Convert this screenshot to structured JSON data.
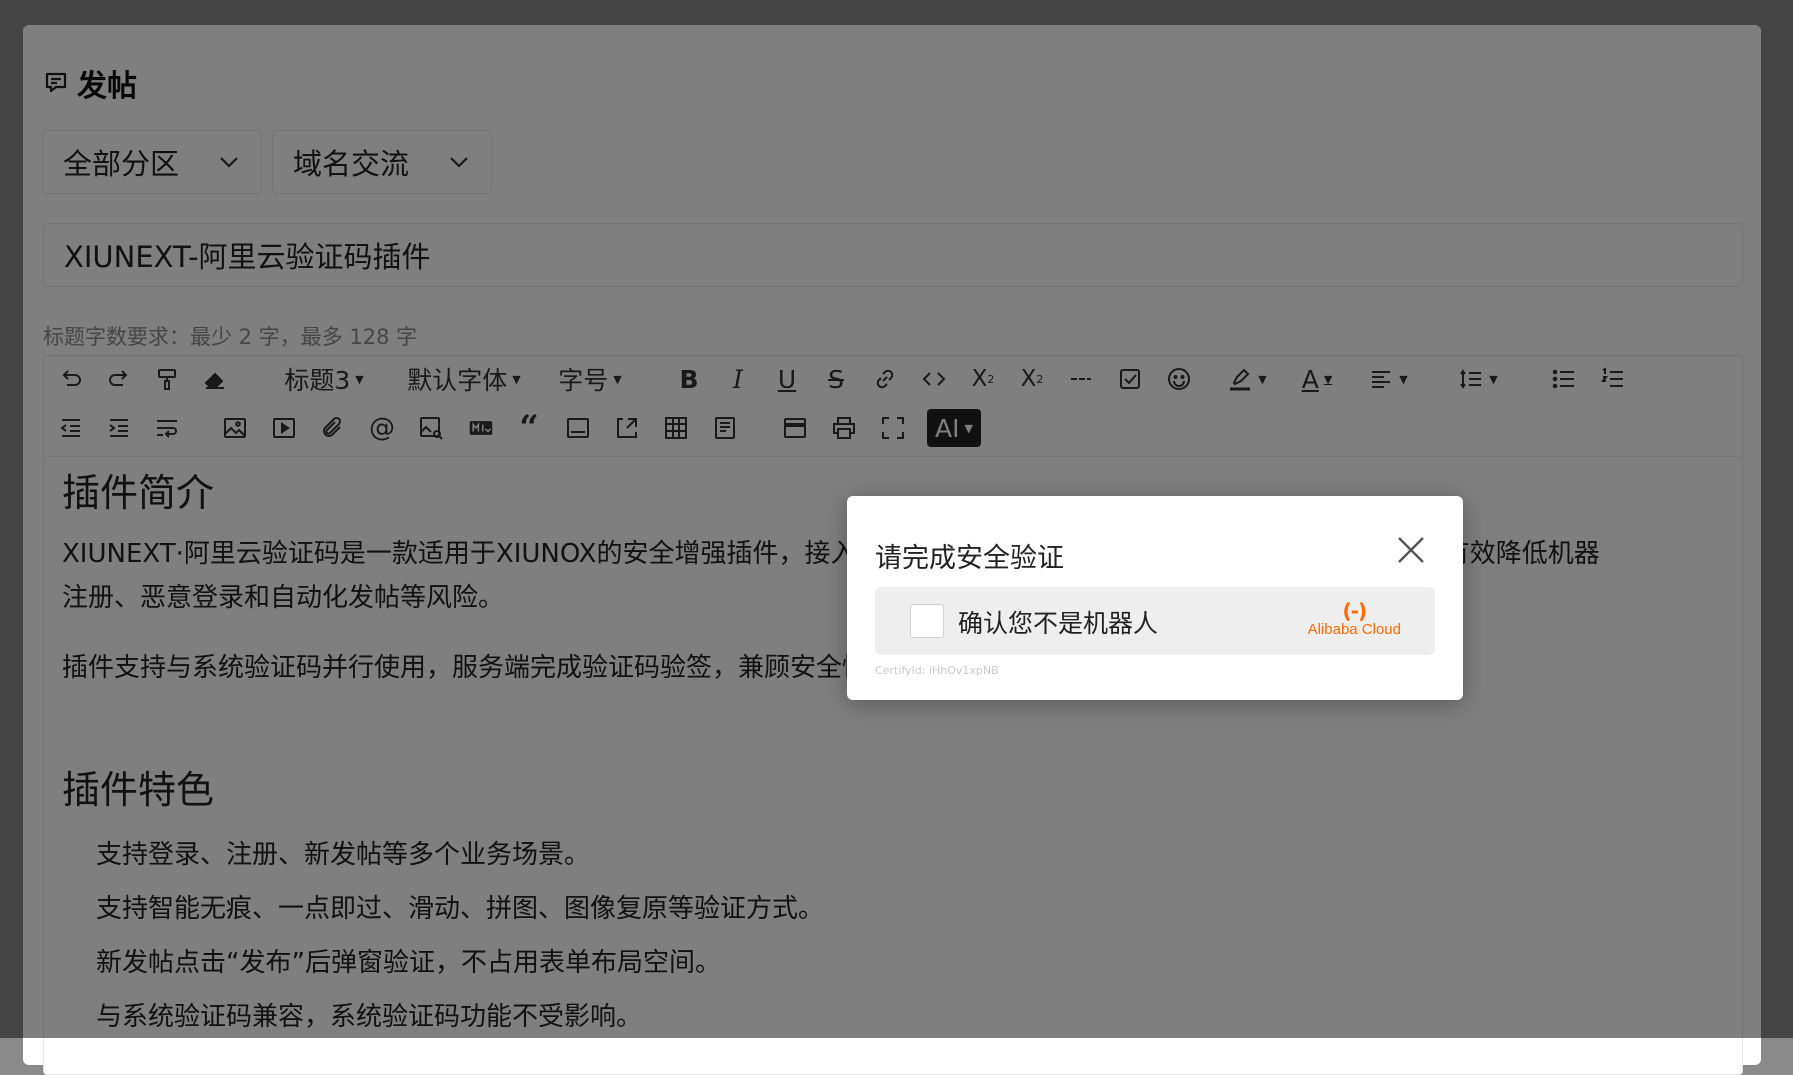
{
  "page": {
    "title": "发帖",
    "icon": "post-icon"
  },
  "selects": [
    {
      "value": "全部分区"
    },
    {
      "value": "域名交流"
    }
  ],
  "title_input": {
    "value": "XIUNEXT-阿里云验证码插件"
  },
  "hint": "标题字数要求：最少 2 字，最多 128 字",
  "toolbar": {
    "heading": "标题3",
    "font": "默认字体",
    "size": "字号",
    "ai": "AI"
  },
  "content": {
    "h1": "插件简介",
    "p1_line1": "XIUNEXT·阿里云验证码是一款适用于XIUNOX的安全增强插件，接入阿里云验证码2.0服务，为站点提供人机验证能力，有效降低机器",
    "p1_line2": "注册、恶意登录和自动化发帖等风险。",
    "p2": "插件支持与系统验证码并行使用，服务端完成验证码验签，兼顾安全性、兼容性与用户体验。",
    "h2": "插件特色",
    "items": [
      "支持登录、注册、新发帖等多个业务场景。",
      "支持智能无痕、一点即过、滑动、拼图、图像复原等验证方式。",
      "新发帖点击“发布”后弹窗验证，不占用表单布局空间。",
      "与系统验证码兼容，系统验证码功能不受影响。"
    ]
  },
  "dialog": {
    "title": "请完成安全验证",
    "checkbox_label": "确认您不是机器人",
    "brand_logo": "(-)",
    "brand_name": "Alibaba Cloud",
    "cert": "CertifyId: iHhOv1xpNB"
  },
  "colors": {
    "overlay": "rgba(0,0,0,0.5)",
    "brand": "#ff6a00",
    "ai_button": "#222222"
  }
}
